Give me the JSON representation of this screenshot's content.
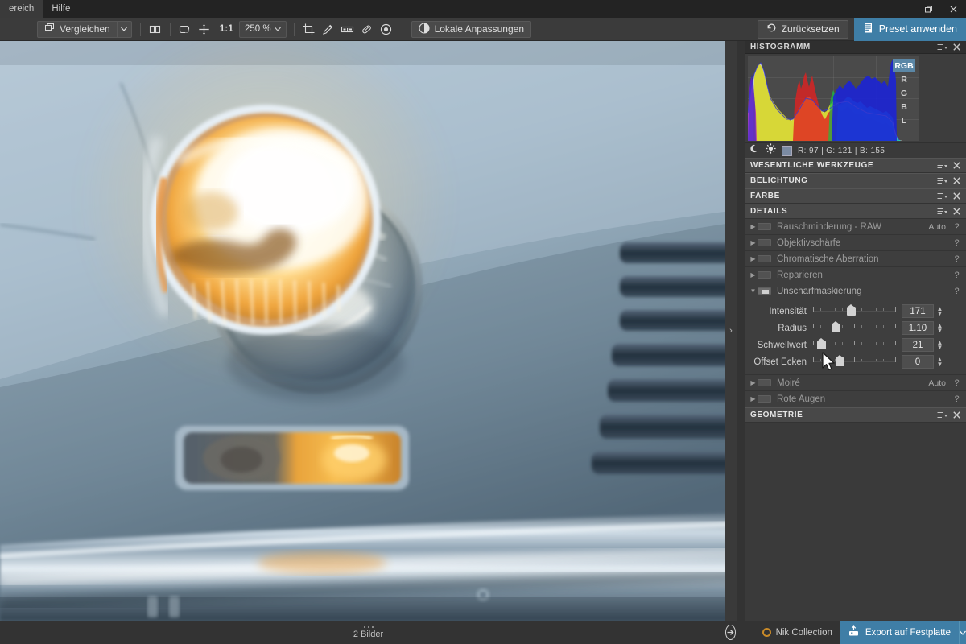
{
  "window": {
    "menu": [
      "ereich",
      "Hilfe"
    ],
    "controls": {
      "minimize": "minimize-icon",
      "restore": "restore-icon",
      "close": "close-icon"
    }
  },
  "toolbar": {
    "compare_label": "Vergleichen",
    "compare_caret": "▾",
    "split_view_icon": "split-view-icon",
    "fit_icon": "fit-to-screen-icon",
    "pan_icon": "pan-hand-icon",
    "ratio_label": "1:1",
    "zoom_value": "250 %",
    "zoom_caret": "▾",
    "crop_icon": "crop-icon",
    "eyedropper_icon": "eyedropper-icon",
    "horizon_icon": "horizon-icon",
    "repair_icon": "repair-patch-icon",
    "redeye_icon": "red-eye-icon",
    "local_adjust_label": "Lokale Anpassungen",
    "reset_label": "Zurücksetzen",
    "apply_preset_label": "Preset anwenden"
  },
  "histogram": {
    "title": "HISTOGRAMM",
    "channels": [
      "RGB",
      "R",
      "G",
      "B",
      "L"
    ],
    "active_channel": "RGB",
    "shadow_icon": "moon-icon",
    "highlight_icon": "sun-icon",
    "swatch_color": "#7b8ba3",
    "readout": "R:    97   |   G:  121   |   B:  155",
    "rgb": {
      "r": 97,
      "g": 121,
      "b": 155
    }
  },
  "panel_sections": [
    {
      "title": "WESENTLICHE WERKZEUGE"
    },
    {
      "title": "BELICHTUNG"
    },
    {
      "title": "FARBE"
    },
    {
      "title": "DETAILS"
    }
  ],
  "details_tools": [
    {
      "name": "Rauschminderung - RAW",
      "auto": "Auto",
      "help": "?",
      "expanded": false,
      "enabled": false
    },
    {
      "name": "Objektivschärfe",
      "auto": "",
      "help": "?",
      "expanded": false,
      "enabled": false
    },
    {
      "name": "Chromatische Aberration",
      "auto": "",
      "help": "?",
      "expanded": false,
      "enabled": false
    },
    {
      "name": "Reparieren",
      "auto": "",
      "help": "?",
      "expanded": false,
      "enabled": false
    },
    {
      "name": "Unscharfmaskierung",
      "auto": "",
      "help": "?",
      "expanded": true,
      "enabled": true
    }
  ],
  "sharpen_sliders": [
    {
      "label": "Intensität",
      "value": "171",
      "pos_pct": 46
    },
    {
      "label": "Radius",
      "value": "1.10",
      "pos_pct": 27
    },
    {
      "label": "Schwellwert",
      "value": "21",
      "pos_pct": 9
    },
    {
      "label": "Offset Ecken",
      "value": "0",
      "pos_pct": 32
    }
  ],
  "details_tools_after": [
    {
      "name": "Moiré",
      "auto": "Auto",
      "help": "?"
    },
    {
      "name": "Rote Augen",
      "auto": "",
      "help": "?"
    }
  ],
  "geometry_section": {
    "title": "GEOMETRIE"
  },
  "filmstrip": {
    "count_label": "2 Bilder"
  },
  "statusbar": {
    "next_icon": "arrow-right-circle-icon",
    "nik_label": "Nik Collection",
    "export_label": "Export auf Festplatte",
    "export_caret": "▾"
  },
  "viewer": {
    "collapse_icon": "›",
    "image_description": "Nahaufnahme eines hellblauen Oldtimers mit leuchtendem Scheinwerfer"
  },
  "colors": {
    "accent": "#3f7ea6",
    "panel_bg": "#3a3a3a",
    "toolbar_bg": "#3b3b3b",
    "titlebar_bg": "#232323"
  }
}
